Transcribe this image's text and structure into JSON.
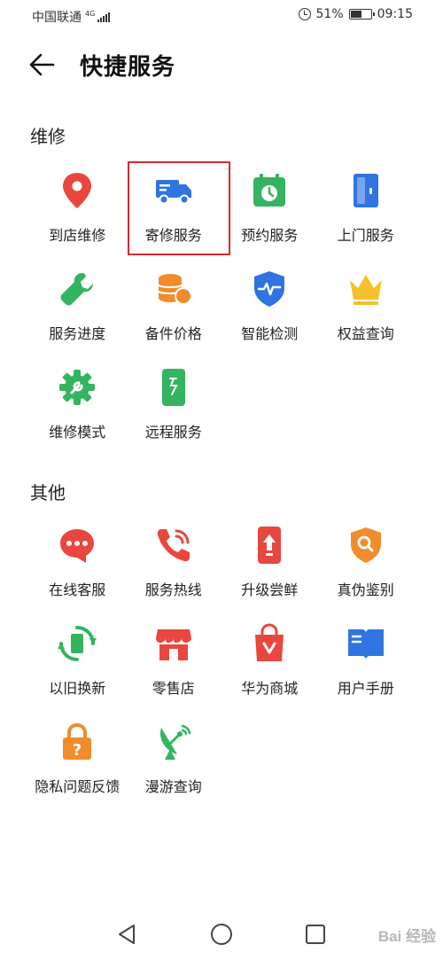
{
  "status_bar": {
    "carrier": "中国联通",
    "network": "4G",
    "battery": "51%",
    "time": "09:15"
  },
  "header": {
    "title": "快捷服务"
  },
  "sections": [
    {
      "title": "维修",
      "items": [
        {
          "label": "到店维修",
          "icon": "location-pin-icon",
          "color": "#e8473f"
        },
        {
          "label": "寄修服务",
          "icon": "delivery-truck-icon",
          "color": "#2f74e0",
          "highlighted": true
        },
        {
          "label": "预约服务",
          "icon": "calendar-clock-icon",
          "color": "#34b460"
        },
        {
          "label": "上门服务",
          "icon": "door-icon",
          "color": "#2f74e0"
        },
        {
          "label": "服务进度",
          "icon": "wrench-icon",
          "color": "#34b460"
        },
        {
          "label": "备件价格",
          "icon": "coins-icon",
          "color": "#f08c2c"
        },
        {
          "label": "智能检测",
          "icon": "shield-pulse-icon",
          "color": "#2f74e0"
        },
        {
          "label": "权益查询",
          "icon": "crown-icon",
          "color": "#f5c02c"
        },
        {
          "label": "维修模式",
          "icon": "gear-wrench-icon",
          "color": "#34b460"
        },
        {
          "label": "远程服务",
          "icon": "remote-phone-icon",
          "color": "#34b460"
        }
      ]
    },
    {
      "title": "其他",
      "items": [
        {
          "label": "在线客服",
          "icon": "chat-bubble-icon",
          "color": "#e8473f"
        },
        {
          "label": "服务热线",
          "icon": "phone-call-icon",
          "color": "#e8473f"
        },
        {
          "label": "升级尝鲜",
          "icon": "upgrade-phone-icon",
          "color": "#e8473f"
        },
        {
          "label": "真伪鉴别",
          "icon": "shield-search-icon",
          "color": "#f08c2c"
        },
        {
          "label": "以旧换新",
          "icon": "trade-in-icon",
          "color": "#34b460"
        },
        {
          "label": "零售店",
          "icon": "store-icon",
          "color": "#e8473f"
        },
        {
          "label": "华为商城",
          "icon": "shopping-bag-icon",
          "color": "#e8473f"
        },
        {
          "label": "用户手册",
          "icon": "book-icon",
          "color": "#2f74e0"
        },
        {
          "label": "隐私问题反馈",
          "icon": "privacy-lock-icon",
          "color": "#f08c2c"
        },
        {
          "label": "漫游查询",
          "icon": "satellite-dish-icon",
          "color": "#34b460"
        }
      ]
    }
  ],
  "watermark": "Bai 经验"
}
